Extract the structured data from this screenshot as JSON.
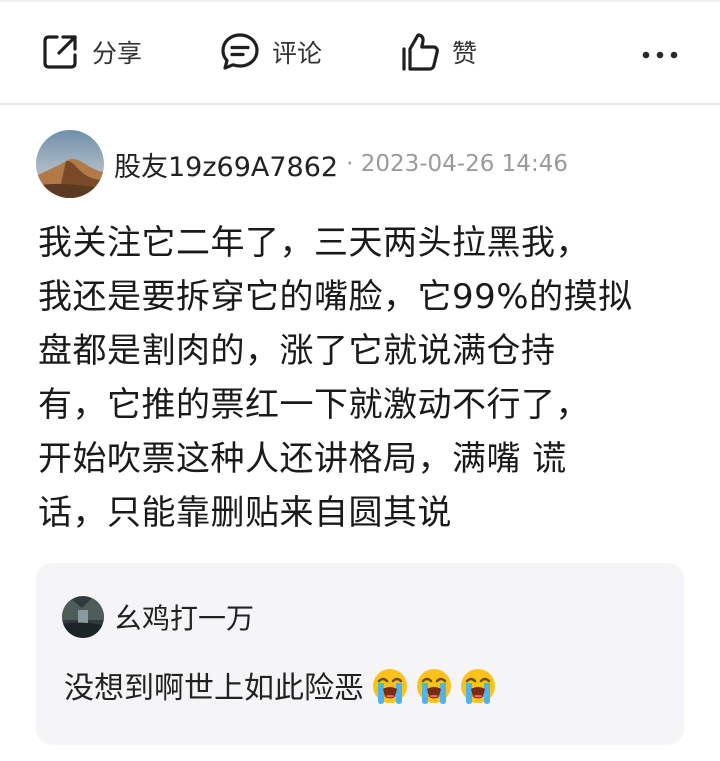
{
  "actions": {
    "share_label": "分享",
    "comment_label": "评论",
    "like_label": "赞",
    "share_icon": "share-external-icon",
    "comment_icon": "comment-bubble-icon",
    "like_icon": "thumbs-up-icon",
    "more_icon": "more-horizontal-icon"
  },
  "post": {
    "username": "股友19z69A7862",
    "meta": "· 2023-04-26 14:46",
    "content": "我关注它二年了，三天两头拉黑我，\n我还是要拆穿它的嘴脸，它99%的摸拟\n盘都是割肉的，涨了它就说满仓持\n有，它推的票红一下就激动不行了，\n开始吹票这种人还讲格局，满嘴 谎\n话，只能靠删贴来自圆其说"
  },
  "reply": {
    "username": "幺鸡打一万",
    "content": "没想到啊世上如此险恶",
    "emojis": [
      "loudly-crying-face-emoji",
      "loudly-crying-face-emoji",
      "loudly-crying-face-emoji"
    ]
  },
  "colors": {
    "text": "#1a1a1a",
    "meta": "#9a9a9a",
    "card_bg": "#f5f5f7",
    "divider": "#e7e7e9"
  }
}
